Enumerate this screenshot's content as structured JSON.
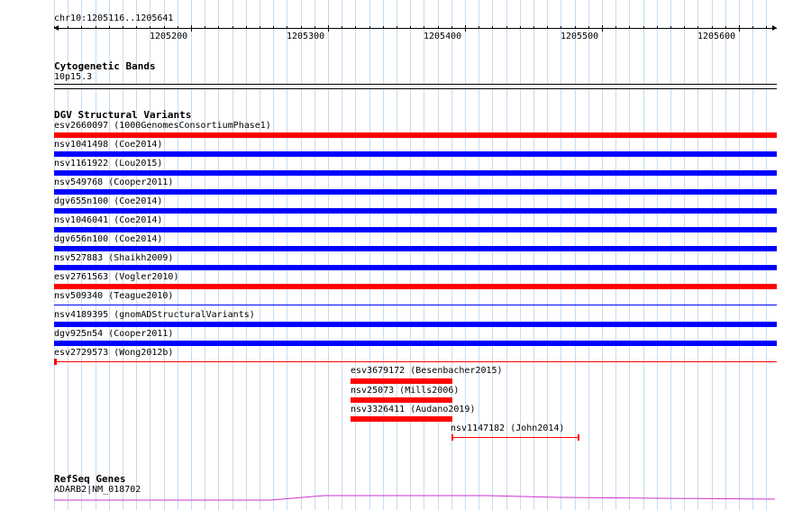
{
  "ruler": {
    "region": "chr10:1205116..1205641",
    "tick_labels": [
      "1205200",
      "1205300",
      "1205400",
      "1205500",
      "1205600"
    ]
  },
  "cytobands": {
    "title": "Cytogenetic Bands",
    "label": "10p15.3"
  },
  "dgv": {
    "title": "DGV Structural Variants",
    "full": [
      {
        "label": "esv2660097 (1000GenomesConsortiumPhase1)",
        "color": "#ff0000"
      },
      {
        "label": "nsv1041498 (Coe2014)",
        "color": "#0000ff"
      },
      {
        "label": "nsv1161922 (Lou2015)",
        "color": "#0000ff"
      },
      {
        "label": "nsv549768 (Cooper2011)",
        "color": "#0000ff"
      },
      {
        "label": "dgv655n100 (Coe2014)",
        "color": "#0000ff"
      },
      {
        "label": "nsv1046041 (Coe2014)",
        "color": "#0000ff"
      },
      {
        "label": "dgv656n100 (Coe2014)",
        "color": "#0000ff"
      },
      {
        "label": "nsv527883 (Shaikh2009)",
        "color": "#0000ff"
      },
      {
        "label": "esv2761563 (Vogler2010)",
        "color": "#ff0000"
      },
      {
        "label": "nsv509340 (Teague2010)",
        "color": "#0000ff"
      },
      {
        "label": "nsv4189395 (gnomADStructuralVariants)",
        "color": "#0000ff"
      },
      {
        "label": "dgv925n54 (Cooper2011)",
        "color": "#0000ff"
      },
      {
        "label": "esv2729573 (Wong2012b)",
        "color": "#ff0000"
      }
    ],
    "partial": [
      {
        "label": "esv3679172 (Besenbacher2015)",
        "color": "#ff0000"
      },
      {
        "label": "nsv25073 (Mills2006)",
        "color": "#ff0000"
      },
      {
        "label": "nsv3326411 (Audano2019)",
        "color": "#ff0000"
      },
      {
        "label": "nsv1147182 (John2014)",
        "color": "#ff0000"
      }
    ]
  },
  "refseq": {
    "title": "RefSeq Genes",
    "label": "ADARB2|NM_018702",
    "color": "#cc33cc"
  }
}
